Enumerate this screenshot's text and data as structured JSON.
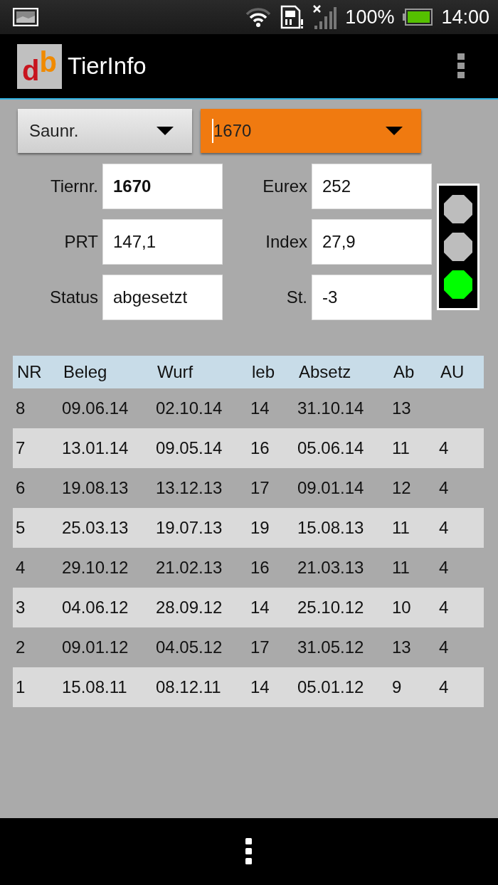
{
  "status_bar": {
    "battery": "100%",
    "time": "14:00"
  },
  "app_bar": {
    "title": "TierInfo",
    "logo": "db"
  },
  "filters": [
    {
      "value": "Saunr.",
      "highlighted": false
    },
    {
      "value": "1670",
      "highlighted": true
    }
  ],
  "fields": [
    {
      "label": "Tiernr.",
      "value": "1670",
      "bold": true
    },
    {
      "label": "Eurex",
      "value": "252",
      "bold": false
    },
    {
      "label": "PRT",
      "value": "147,1",
      "bold": false
    },
    {
      "label": "Index",
      "value": "27,9",
      "bold": false
    },
    {
      "label": "Status",
      "value": "abgesetzt",
      "bold": false
    },
    {
      "label": "St.",
      "value": "-3",
      "bold": false
    }
  ],
  "traffic_light": [
    {
      "on": false
    },
    {
      "on": false
    },
    {
      "on": true,
      "color": "#00ff00"
    }
  ],
  "table": {
    "columns": [
      "NR",
      "Beleg",
      "Wurf",
      "leb",
      "Absetz",
      "Ab",
      "AU"
    ],
    "rows": [
      [
        "8",
        "09.06.14",
        "02.10.14",
        "14",
        "31.10.14",
        "13",
        ""
      ],
      [
        "7",
        "13.01.14",
        "09.05.14",
        "16",
        "05.06.14",
        "11",
        "4"
      ],
      [
        "6",
        "19.08.13",
        "13.12.13",
        "17",
        "09.01.14",
        "12",
        "4"
      ],
      [
        "5",
        "25.03.13",
        "19.07.13",
        "19",
        "15.08.13",
        "11",
        "4"
      ],
      [
        "4",
        "29.10.12",
        "21.02.13",
        "16",
        "21.03.13",
        "11",
        "4"
      ],
      [
        "3",
        "04.06.12",
        "28.09.12",
        "14",
        "25.10.12",
        "10",
        "4"
      ],
      [
        "2",
        "09.01.12",
        "04.05.12",
        "17",
        "31.05.12",
        "13",
        "4"
      ],
      [
        "1",
        "15.08.11",
        "08.12.11",
        "14",
        "05.01.12",
        "9",
        "4"
      ]
    ]
  }
}
